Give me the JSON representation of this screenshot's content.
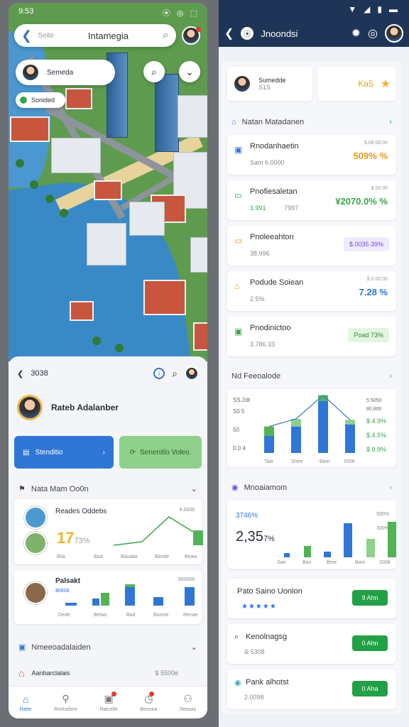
{
  "left": {
    "status": {
      "time": "9:53",
      "icons": [
        "⦿",
        "◎",
        "⬚"
      ]
    },
    "search": {
      "back": "❮",
      "placeholder": "Seite",
      "title": "Intamegia",
      "search_icon": "⌕"
    },
    "user_card": {
      "name": "Semeda",
      "sub": "Sonided"
    },
    "map_buttons": [
      "⌕",
      "⌄"
    ],
    "sheet": {
      "header": {
        "label": "3038"
      },
      "profile_name": "Rateb Adalanber",
      "btn_primary": "Stenditio",
      "btn_secondary": "Senenitlo Voleo.",
      "section1": {
        "title": "Nata Mam Oo0n"
      },
      "card1": {
        "title": "Reades Oddebs",
        "value_label": "8.5008",
        "big": "17",
        "big_unit": "73%",
        "axis": [
          "80a",
          "Bad",
          "Bauatia",
          "Bande",
          "Beaw"
        ]
      },
      "card2": {
        "title": "Palsakt",
        "subtitle": "$6808",
        "value_label": "300008",
        "axis": [
          "Dede",
          "Belaa",
          "Bad",
          "Bancie",
          "Renae"
        ]
      },
      "section2": {
        "title": "Nmeeoadalaiden"
      },
      "card3": {
        "title": "Aanbarclalais",
        "value": "$ 5500e"
      }
    },
    "nav": [
      {
        "icon": "⌂",
        "label": "Ratte"
      },
      {
        "icon": "⚲",
        "label": "Rrelisebse"
      },
      {
        "icon": "▣",
        "label": "Ratcelle"
      },
      {
        "icon": "◷",
        "label": "Beooea"
      },
      {
        "icon": "⚇",
        "label": "Seasas"
      }
    ]
  },
  "right": {
    "status": {
      "icons": [
        "▼",
        "◢",
        "▮",
        "▬"
      ]
    },
    "header": {
      "back": "❮",
      "pill": "⦿",
      "title": "Jnoondsi",
      "icons": [
        "✹",
        "◎"
      ]
    },
    "top_card": {
      "name": "Sumedde",
      "sub": "S1S"
    },
    "top_value": "Ka5",
    "section1": "Natan Matadanen",
    "items": [
      {
        "name": "Rnodanhaetin",
        "sub": "Sam 6.0000",
        "label": "$.08.08.00",
        "value": "509% %",
        "color": "#e59a1a",
        "icon": "▣",
        "iconColor": "#2f76d6"
      },
      {
        "name": "Pnofiesaletan",
        "sub": "3.991",
        "sub2": "7997",
        "label": "$.00.00",
        "value": "¥2070.0% %",
        "color": "#3aa44a",
        "icon": "▭",
        "iconColor": "#3aa44a"
      },
      {
        "name": "Pnoleeahton",
        "sub": "38.996",
        "label": "",
        "chip": "$.0035 39%",
        "chipBg": "#f0eafd",
        "chipColor": "#6a4dd0",
        "icon": "▭",
        "iconColor": "#e59a1a"
      },
      {
        "name": "Podude Soiean",
        "sub": "2.5%",
        "label": "$.0.00.00",
        "value": "7.28 %",
        "color": "#2f76d6",
        "icon": "⌂",
        "iconColor": "#e59a1a"
      },
      {
        "name": "Pnodinictoo",
        "sub": "3.786 33",
        "label": "",
        "chip": "Poad 73%",
        "chipBg": "#e3f4df",
        "chipColor": "#2c8a3a",
        "icon": "▣",
        "iconColor": "#3aa44a"
      }
    ],
    "chart1": {
      "title": "Nd Feeoalode",
      "y_labels": [
        "SS.2dt",
        "S0 5",
        "50",
        "0.0 4"
      ],
      "side_values": [
        "5.5050",
        "80.800",
        "$.4.9%",
        "$.4.5%",
        "$.9.9%"
      ],
      "x_labels": [
        "Taie",
        "Snee",
        "Bam",
        "2008"
      ]
    },
    "chart_data": {
      "type": "bar",
      "categories": [
        "Taie",
        "Snee",
        "Bam",
        "2008"
      ],
      "series": [
        {
          "values": [
            18,
            28,
            55,
            30
          ]
        },
        {
          "values": [
            10,
            8,
            6,
            5
          ]
        }
      ],
      "xlabel": "",
      "ylabel": "",
      "ylim": [
        0,
        60
      ]
    },
    "section2": "Mnoaiamom",
    "chart2": {
      "left_pct": "3746%",
      "big": "2,35",
      "big_unit": "7%",
      "right_vals": [
        "500%",
        "300%"
      ],
      "x_labels": [
        "Sae",
        "Ban",
        "Beie",
        "Bam",
        "2008"
      ]
    },
    "rows": [
      {
        "name": "Pato Saino Uonlon",
        "stars": "★★★★★",
        "btn": "9 Ahn"
      },
      {
        "name": "Kenolnagsg",
        "sub": "& 5308",
        "btn": "0 Ahn"
      },
      {
        "name": "Pank alhotst",
        "sub": "2.0098",
        "btn": "0 Aha"
      }
    ]
  }
}
